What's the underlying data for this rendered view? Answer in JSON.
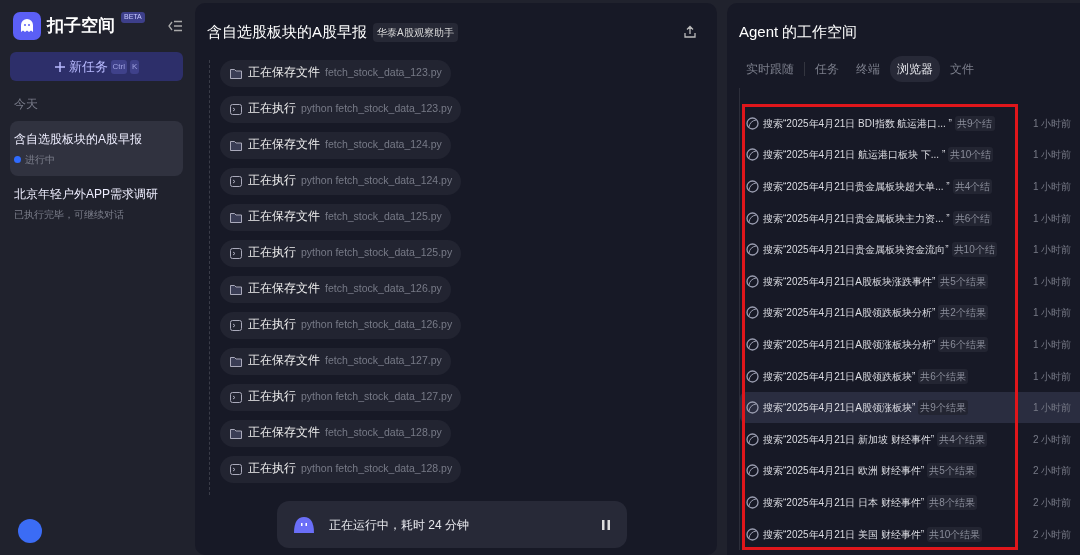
{
  "sidebar": {
    "logo_text": "扣子空间",
    "badge": "BETA",
    "new_task": {
      "label": "新任务",
      "shortcut_keys": [
        "Ctrl",
        "K"
      ]
    },
    "section": "今天",
    "tasks": [
      {
        "title": "含自选股板块的A股早报",
        "status": "进行中",
        "running": true,
        "selected": true
      },
      {
        "title": "北京年轻户外APP需求调研",
        "status": "已执行完毕，可继续对话",
        "running": false,
        "selected": false
      }
    ]
  },
  "main": {
    "title": "含自选股板块的A股早报",
    "tag": "华泰A股观察助手",
    "steps": [
      {
        "kind": "save",
        "action": "正在保存文件",
        "detail": "fetch_stock_data_123.py"
      },
      {
        "kind": "exec",
        "action": "正在执行",
        "detail": "python fetch_stock_data_123.py"
      },
      {
        "kind": "save",
        "action": "正在保存文件",
        "detail": "fetch_stock_data_124.py"
      },
      {
        "kind": "exec",
        "action": "正在执行",
        "detail": "python fetch_stock_data_124.py"
      },
      {
        "kind": "save",
        "action": "正在保存文件",
        "detail": "fetch_stock_data_125.py"
      },
      {
        "kind": "exec",
        "action": "正在执行",
        "detail": "python fetch_stock_data_125.py"
      },
      {
        "kind": "save",
        "action": "正在保存文件",
        "detail": "fetch_stock_data_126.py"
      },
      {
        "kind": "exec",
        "action": "正在执行",
        "detail": "python fetch_stock_data_126.py"
      },
      {
        "kind": "save",
        "action": "正在保存文件",
        "detail": "fetch_stock_data_127.py"
      },
      {
        "kind": "exec",
        "action": "正在执行",
        "detail": "python fetch_stock_data_127.py"
      },
      {
        "kind": "save",
        "action": "正在保存文件",
        "detail": "fetch_stock_data_128.py"
      },
      {
        "kind": "exec",
        "action": "正在执行",
        "detail": "python fetch_stock_data_128.py"
      }
    ],
    "status_bar": {
      "text": "正在运行中，耗时 24 分钟"
    }
  },
  "workspace": {
    "title": "Agent 的工作空间",
    "tabs": [
      {
        "label": "实时跟随",
        "selected": false
      },
      {
        "label": "任务",
        "selected": false
      },
      {
        "label": "终端",
        "selected": false
      },
      {
        "label": "浏览器",
        "selected": true
      },
      {
        "label": "文件",
        "selected": false
      }
    ],
    "highlighted": true,
    "results": [
      {
        "query": "搜索“2025年4月21日 BDI指数 航运港口...  ”",
        "count": "共9个结",
        "time": "1 小时前",
        "selected": false
      },
      {
        "query": "搜索“2025年4月21日 航运港口板块 下...  ”",
        "count": "共10个结",
        "time": "1 小时前",
        "selected": false
      },
      {
        "query": "搜索“2025年4月21日贵金属板块超大单...  ”",
        "count": "共4个结",
        "time": "1 小时前",
        "selected": false
      },
      {
        "query": "搜索“2025年4月21日贵金属板块主力资...  ”",
        "count": "共6个结",
        "time": "1 小时前",
        "selected": false
      },
      {
        "query": "搜索“2025年4月21日贵金属板块资金流向”",
        "count": "共10个结",
        "time": "1 小时前",
        "selected": false
      },
      {
        "query": "搜索“2025年4月21日A股板块涨跌事件”",
        "count": "共5个结果",
        "time": "1 小时前",
        "selected": false
      },
      {
        "query": "搜索“2025年4月21日A股领跌板块分析”",
        "count": "共2个结果",
        "time": "1 小时前",
        "selected": false
      },
      {
        "query": "搜索“2025年4月21日A股领涨板块分析”",
        "count": "共6个结果",
        "time": "1 小时前",
        "selected": false
      },
      {
        "query": "搜索“2025年4月21日A股领跌板块”",
        "count": "共6个结果",
        "time": "1 小时前",
        "selected": false
      },
      {
        "query": "搜索“2025年4月21日A股领涨板块”",
        "count": "共9个结果",
        "time": "1 小时前",
        "selected": true
      },
      {
        "query": "搜索“2025年4月21日 新加坡 财经事件”",
        "count": "共4个结果",
        "time": "2 小时前",
        "selected": false
      },
      {
        "query": "搜索“2025年4月21日 欧洲 财经事件”",
        "count": "共5个结果",
        "time": "2 小时前",
        "selected": false
      },
      {
        "query": "搜索“2025年4月21日 日本 财经事件”",
        "count": "共8个结果",
        "time": "2 小时前",
        "selected": false
      },
      {
        "query": "搜索“2025年4月21日 美国 财经事件”",
        "count": "共10个结果",
        "time": "2 小时前",
        "selected": false
      }
    ]
  }
}
